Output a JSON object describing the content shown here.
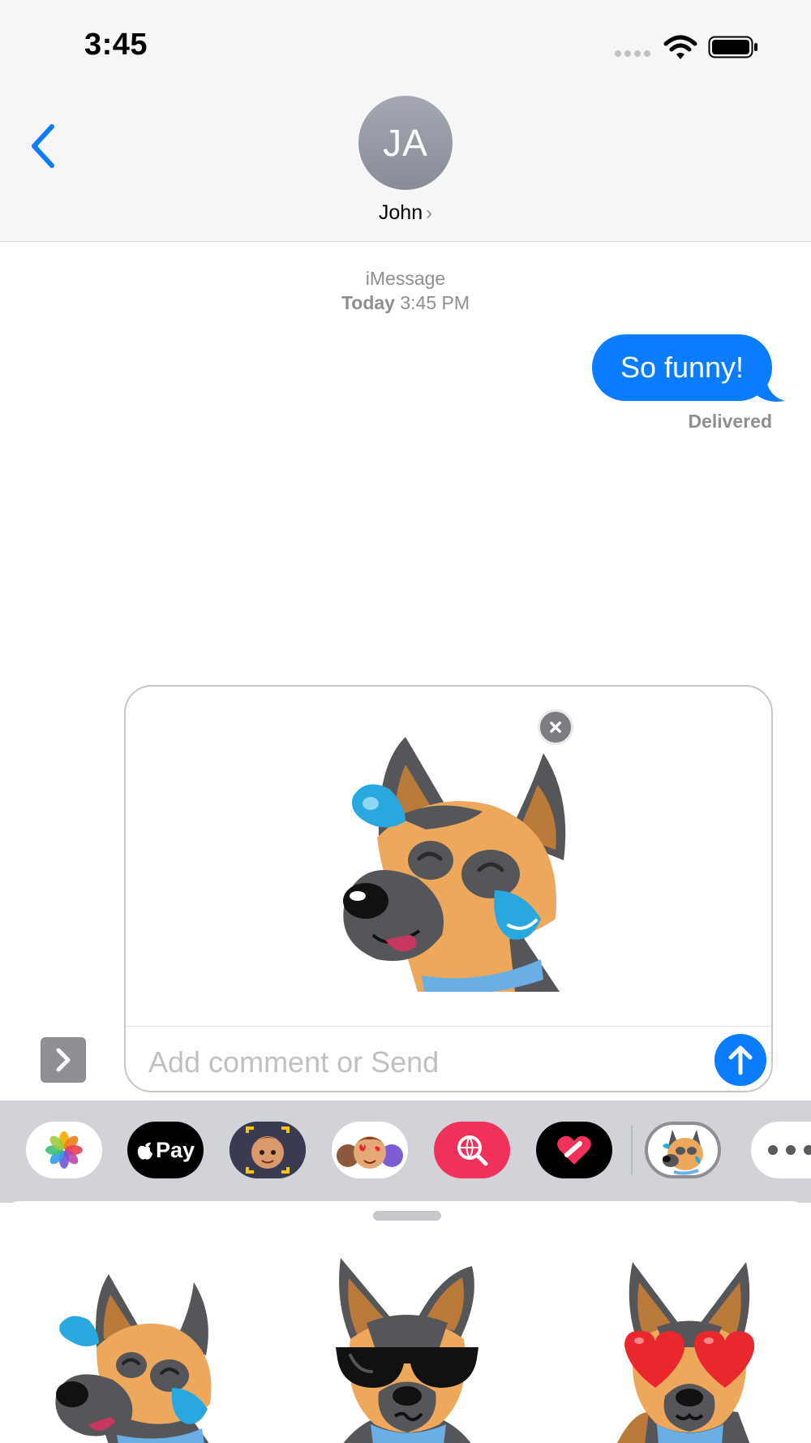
{
  "status_bar": {
    "time": "3:45"
  },
  "header": {
    "avatar_initials": "JA",
    "contact_name": "John",
    "chevron": "›"
  },
  "conversation": {
    "service": "iMessage",
    "date_label": "Today",
    "time": "3:45 PM",
    "messages": [
      {
        "sender": "me",
        "text": "So funny!"
      }
    ],
    "status": "Delivered"
  },
  "compose": {
    "placeholder": "Add comment or Send",
    "attached_sticker": "dog-laughing-tears-sticker"
  },
  "app_strip": {
    "apps": [
      {
        "name": "photos-app-icon"
      },
      {
        "name": "apple-pay-app",
        "label": "Pay"
      },
      {
        "name": "memoji-camera-app-icon"
      },
      {
        "name": "memoji-stickers-app-icon"
      },
      {
        "name": "images-search-app-icon"
      },
      {
        "name": "digital-touch-app-icon"
      },
      {
        "name": "dog-sticker-pack-app-icon",
        "selected": true
      },
      {
        "name": "more-apps-icon"
      }
    ]
  },
  "drawer": {
    "stickers": [
      {
        "name": "dog-laughing-tears-sticker"
      },
      {
        "name": "dog-sunglasses-sticker"
      },
      {
        "name": "dog-heart-eyes-sticker"
      }
    ]
  },
  "colors": {
    "accent": "#0a7cff",
    "dog_tan": "#eda85c",
    "dog_dark": "#545659",
    "collar": "#6aaee6",
    "tears": "#29a8e0",
    "hearts": "#e8282d"
  }
}
